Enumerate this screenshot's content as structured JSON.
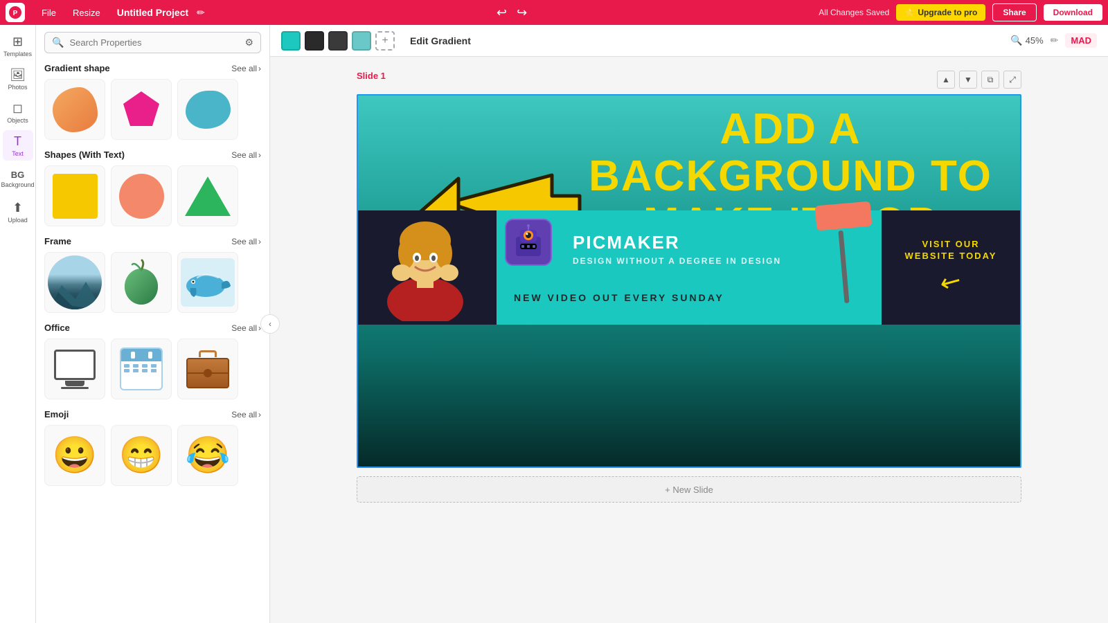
{
  "topbar": {
    "logo": "P",
    "menu": [
      "File",
      "Resize"
    ],
    "project_name": "Untitled Project",
    "saved_label": "All Changes Saved",
    "upgrade_label": "Upgrade to pro",
    "share_label": "Share",
    "download_label": "Download",
    "star_icon": "⭐"
  },
  "toolbar": {
    "colors": [
      "#1dc8bf",
      "#2a2a2a",
      "#3a3a3a",
      "#6ac8c8",
      "#eeeeee"
    ],
    "edit_gradient_label": "Edit Gradient",
    "zoom_label": "45%",
    "user_label": "MAD",
    "pencil_icon": "✏"
  },
  "left_panel": {
    "search_placeholder": "Search Properties",
    "sections": [
      {
        "title": "Gradient shape",
        "see_all": "See all"
      },
      {
        "title": "Shapes (With Text)",
        "see_all": "See all"
      },
      {
        "title": "Frame",
        "see_all": "See all"
      },
      {
        "title": "Office",
        "see_all": "See all"
      },
      {
        "title": "Emoji",
        "see_all": "See all"
      }
    ]
  },
  "icon_rail": [
    {
      "label": "Templates",
      "icon": "⊞"
    },
    {
      "label": "Photos",
      "icon": "🖼"
    },
    {
      "label": "Objects",
      "icon": "◻"
    },
    {
      "label": "Text",
      "icon": "T"
    },
    {
      "label": "BG",
      "icon": "BG"
    },
    {
      "label": "Upload",
      "icon": "⬆"
    }
  ],
  "canvas": {
    "slide_label": "Slide 1",
    "headline1": "ADD A",
    "headline2": "BACKGROUND TO",
    "headline3": "MAKE IT POP",
    "banner_title": "PICMAKER",
    "banner_subtitle": "DESIGN WITHOUT A DEGREE IN DESIGN",
    "banner_bottom": "NEW VIDEO OUT EVERY SUNDAY",
    "visit_text": "VISIT OUR\nWEBSITE TODAY",
    "new_slide_label": "+ New Slide"
  }
}
